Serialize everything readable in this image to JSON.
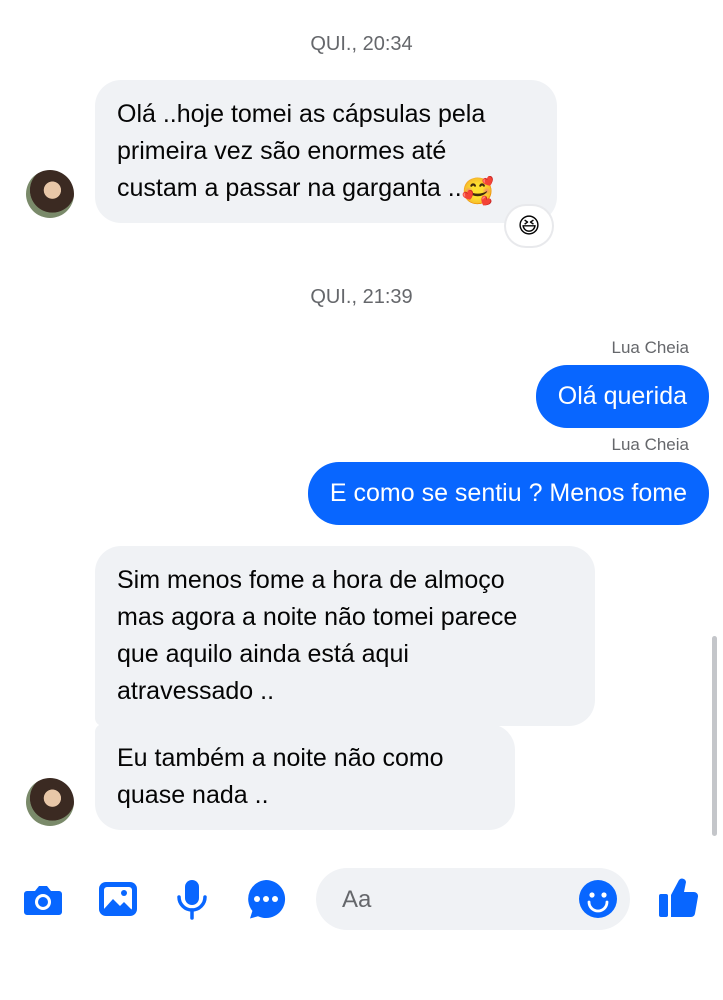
{
  "accent_color": "#0866ff",
  "chat": {
    "timestamp_1": "QUI., 20:34",
    "message_1_lines": [
      "Olá ..hoje tomei as cápsulas pela",
      "primeira vez são enormes até",
      "custam a passar na garganta .."
    ],
    "message_1_emoji": "🥰",
    "message_1_reaction": "😆",
    "timestamp_2": "QUI., 21:39",
    "sender_1": "Lua Cheia",
    "message_2": "Olá querida",
    "sender_2": "Lua Cheia",
    "message_3": "E como se sentiu ? Menos fome",
    "message_4_lines": [
      "Sim menos fome a hora de almoço",
      "mas agora a noite não tomei parece",
      "que aquilo ainda está aqui",
      "atravessado .."
    ],
    "message_5_lines": [
      "Eu também a noite não como",
      "quase nada .."
    ]
  },
  "composer": {
    "placeholder": "Aa",
    "icons": [
      "camera-icon",
      "image-icon",
      "microphone-icon",
      "more-icon",
      "emoji-icon",
      "thumbs-up-icon"
    ]
  }
}
